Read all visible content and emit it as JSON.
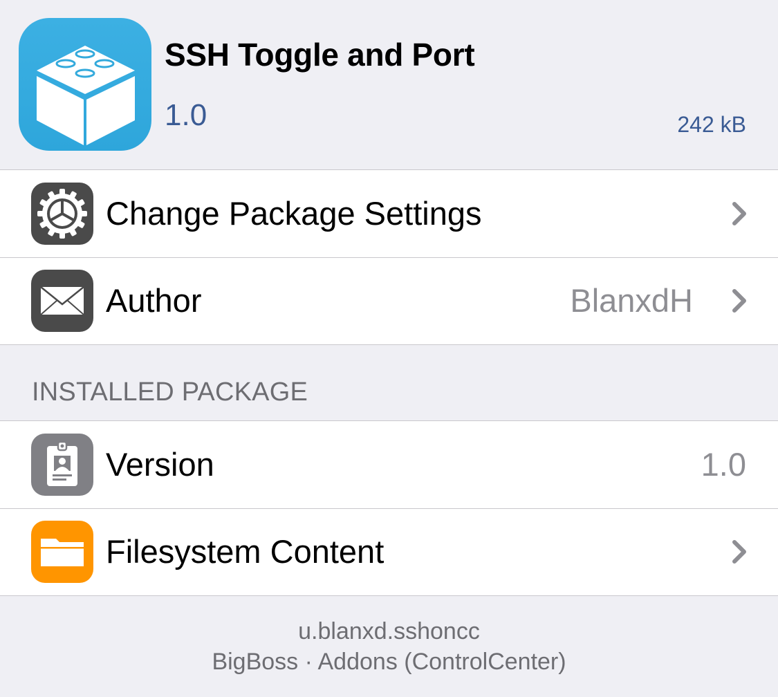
{
  "package": {
    "name": "SSH Toggle and Port",
    "version": "1.0",
    "size": "242 kB",
    "icon": "cydia-package-box-icon",
    "icon_color": "#34aadc"
  },
  "actions": [
    {
      "label": "Change Package Settings",
      "icon": "gear-icon",
      "value": ""
    },
    {
      "label": "Author",
      "icon": "mail-icon",
      "value": "BlanxdH"
    }
  ],
  "installed_section": {
    "header": "INSTALLED PACKAGE",
    "rows": [
      {
        "label": "Version",
        "icon": "id-badge-icon",
        "value": "1.0"
      },
      {
        "label": "Filesystem Content",
        "icon": "folder-icon",
        "value": ""
      }
    ]
  },
  "footer": {
    "identifier": "u.blanxd.sshoncc",
    "repo_line": "BigBoss · Addons (ControlCenter)"
  },
  "colors": {
    "background": "#efeff4",
    "link_blue": "#3a5b94",
    "secondary_text": "#8e8e93",
    "folder_orange": "#ff9500",
    "dark_icon": "#4a4a4a"
  }
}
